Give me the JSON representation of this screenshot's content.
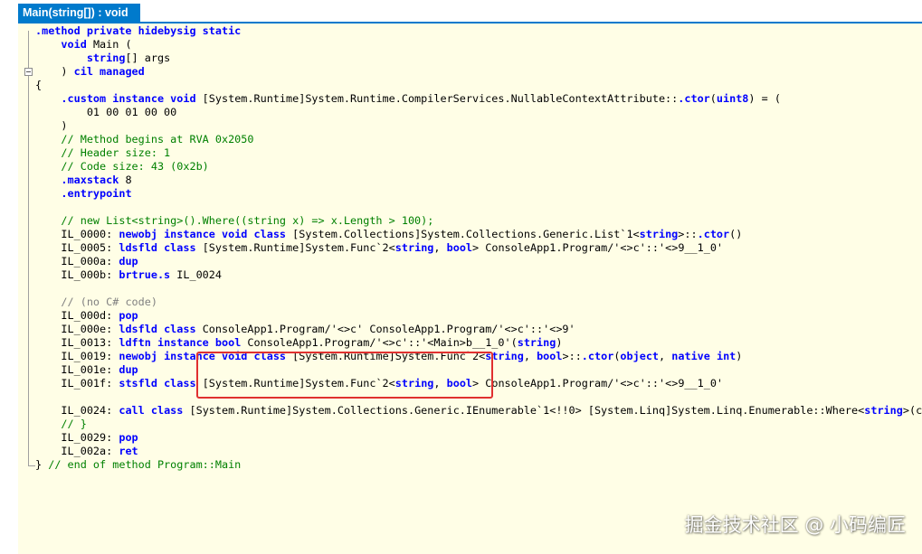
{
  "tab": {
    "title": "Main(string[]) : void"
  },
  "watermark": "掘金技术社区 @ 小码编匠",
  "code_lines": [
    [
      [
        "kw",
        ".method private hidebysig static"
      ]
    ],
    [
      [
        "t",
        "    "
      ],
      [
        "kw",
        "void"
      ],
      [
        "t",
        " Main ("
      ]
    ],
    [
      [
        "t",
        "        "
      ],
      [
        "kw",
        "string"
      ],
      [
        "t",
        "[] args"
      ]
    ],
    [
      [
        "t",
        "    ) "
      ],
      [
        "kw",
        "cil managed"
      ]
    ],
    [
      [
        "t",
        "{"
      ]
    ],
    [
      [
        "t",
        "    "
      ],
      [
        "kw",
        ".custom instance void"
      ],
      [
        "t",
        " [System.Runtime]System.Runtime.CompilerServices.NullableContextAttribute::"
      ],
      [
        "kw",
        ".ctor"
      ],
      [
        "t",
        "("
      ],
      [
        "kw",
        "uint8"
      ],
      [
        "t",
        ") = ("
      ]
    ],
    [
      [
        "t",
        "        01 00 01 00 00"
      ]
    ],
    [
      [
        "t",
        "    )"
      ]
    ],
    [
      [
        "t",
        "    "
      ],
      [
        "cm",
        "// Method begins at RVA 0x2050"
      ]
    ],
    [
      [
        "t",
        "    "
      ],
      [
        "cm",
        "// Header size: 1"
      ]
    ],
    [
      [
        "t",
        "    "
      ],
      [
        "cm",
        "// Code size: 43 (0x2b)"
      ]
    ],
    [
      [
        "t",
        "    "
      ],
      [
        "kw",
        ".maxstack"
      ],
      [
        "t",
        " 8"
      ]
    ],
    [
      [
        "t",
        "    "
      ],
      [
        "kw",
        ".entrypoint"
      ]
    ],
    [],
    [
      [
        "t",
        "    "
      ],
      [
        "cm",
        "// new List<string>().Where((string x) => x.Length > 100);"
      ]
    ],
    [
      [
        "t",
        "    IL_0000: "
      ],
      [
        "kw",
        "newobj"
      ],
      [
        "t",
        " "
      ],
      [
        "kw",
        "instance void class"
      ],
      [
        "t",
        " [System.Collections]System.Collections.Generic.List`1<"
      ],
      [
        "kw",
        "string"
      ],
      [
        "t",
        ">::"
      ],
      [
        "kw",
        ".ctor"
      ],
      [
        "t",
        "()"
      ]
    ],
    [
      [
        "t",
        "    IL_0005: "
      ],
      [
        "kw",
        "ldsfld"
      ],
      [
        "t",
        " "
      ],
      [
        "kw",
        "class"
      ],
      [
        "t",
        " [System.Runtime]System.Func`2<"
      ],
      [
        "kw",
        "string"
      ],
      [
        "t",
        ", "
      ],
      [
        "kw",
        "bool"
      ],
      [
        "t",
        "> ConsoleApp1.Program/'<>c'::'<>9__1_0'"
      ]
    ],
    [
      [
        "t",
        "    IL_000a: "
      ],
      [
        "kw",
        "dup"
      ]
    ],
    [
      [
        "t",
        "    IL_000b: "
      ],
      [
        "kw",
        "brtrue.s"
      ],
      [
        "t",
        " IL_0024"
      ]
    ],
    [],
    [
      [
        "t",
        "    "
      ],
      [
        "cm-gray",
        "// (no C# code)"
      ]
    ],
    [
      [
        "t",
        "    IL_000d: "
      ],
      [
        "kw",
        "pop"
      ]
    ],
    [
      [
        "t",
        "    IL_000e: "
      ],
      [
        "kw",
        "ldsfld"
      ],
      [
        "t",
        " "
      ],
      [
        "kw",
        "class"
      ],
      [
        "t",
        " ConsoleApp1.Program/'<>c' ConsoleApp1.Program/'<>c'::'<>9'"
      ]
    ],
    [
      [
        "t",
        "    IL_0013: "
      ],
      [
        "kw",
        "ldftn"
      ],
      [
        "t",
        " "
      ],
      [
        "kw",
        "instance bool"
      ],
      [
        "t",
        " ConsoleApp1.Program/'<>c'::'<Main>b__1_0'("
      ],
      [
        "kw",
        "string"
      ],
      [
        "t",
        ")"
      ]
    ],
    [
      [
        "t",
        "    IL_0019: "
      ],
      [
        "kw",
        "newobj"
      ],
      [
        "t",
        " "
      ],
      [
        "kw",
        "instance void class"
      ],
      [
        "t",
        " [System.Runtime]System.Func`2<"
      ],
      [
        "kw",
        "string"
      ],
      [
        "t",
        ", "
      ],
      [
        "kw",
        "bool"
      ],
      [
        "t",
        ">::"
      ],
      [
        "kw",
        ".ctor"
      ],
      [
        "t",
        "("
      ],
      [
        "kw",
        "object"
      ],
      [
        "t",
        ", "
      ],
      [
        "kw",
        "native int"
      ],
      [
        "t",
        ")"
      ]
    ],
    [
      [
        "t",
        "    IL_001e: "
      ],
      [
        "kw",
        "dup"
      ]
    ],
    [
      [
        "t",
        "    IL_001f: "
      ],
      [
        "kw",
        "stsfld"
      ],
      [
        "t",
        " "
      ],
      [
        "kw",
        "class"
      ],
      [
        "t",
        " [System.Runtime]System.Func`2<"
      ],
      [
        "kw",
        "string"
      ],
      [
        "t",
        ", "
      ],
      [
        "kw",
        "bool"
      ],
      [
        "t",
        "> ConsoleApp1.Program/'<>c'::'<>9__1_0'"
      ]
    ],
    [],
    [
      [
        "t",
        "    IL_0024: "
      ],
      [
        "kw",
        "call"
      ],
      [
        "t",
        " "
      ],
      [
        "kw",
        "class"
      ],
      [
        "t",
        " [System.Runtime]System.Collections.Generic.IEnumerable`1<!!0> [System.Linq]System.Linq.Enumerable::Where<"
      ],
      [
        "kw",
        "string"
      ],
      [
        "t",
        ">(cla"
      ]
    ],
    [
      [
        "t",
        "    "
      ],
      [
        "cm",
        "// }"
      ]
    ],
    [
      [
        "t",
        "    IL_0029: "
      ],
      [
        "kw",
        "pop"
      ]
    ],
    [
      [
        "t",
        "    IL_002a: "
      ],
      [
        "kw",
        "ret"
      ]
    ],
    [
      [
        "t",
        "} "
      ],
      [
        "cm",
        "// end of method Program::Main"
      ]
    ]
  ]
}
